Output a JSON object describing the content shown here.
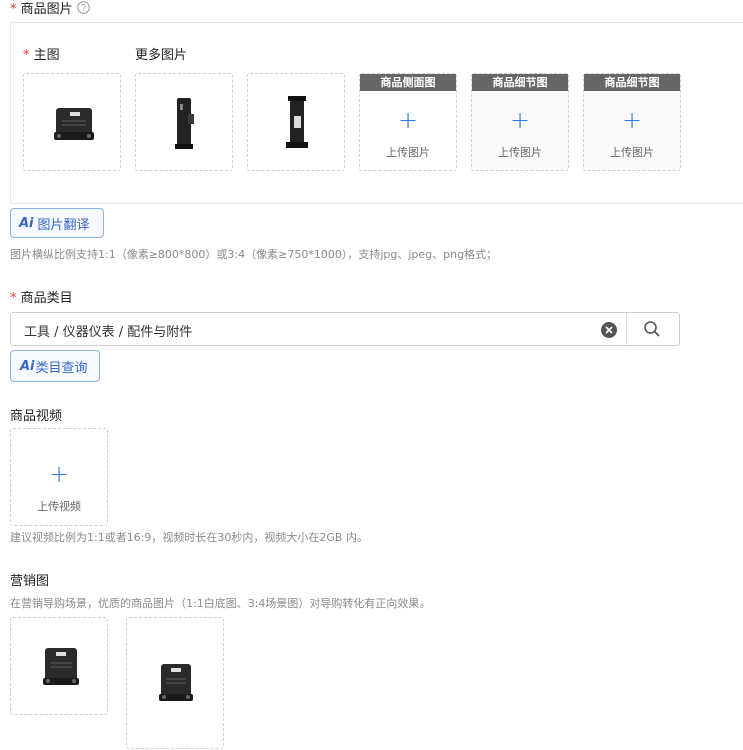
{
  "main_image_section": {
    "required_mark": "*",
    "title": "商品图片",
    "help_icon": "question-circle-icon",
    "main_label": "主图",
    "more_label": "更多图片",
    "tiles": [
      {
        "kind": "image",
        "icon": "device-front-icon"
      },
      {
        "kind": "image",
        "icon": "device-side-icon"
      },
      {
        "kind": "image",
        "icon": "device-side-icon"
      },
      {
        "kind": "upload",
        "header": "商品侧面图",
        "plus": "+",
        "text": "上传图片"
      },
      {
        "kind": "upload",
        "header": "商品细节图",
        "plus": "+",
        "text": "上传图片"
      },
      {
        "kind": "upload",
        "header": "商品细节图",
        "plus": "+",
        "text": "上传图片"
      }
    ],
    "ai_button": {
      "mark": "Ai",
      "label": "图片翻译"
    },
    "hint": "图片横纵比例支持1:1（像素≥800*800）或3:4（像素≥750*1000），支持jpg、jpeg、png格式；"
  },
  "category_section": {
    "required_mark": "*",
    "title": "商品类目",
    "value": "工具 / 仪器仪表 / 配件与附件",
    "ai_button": {
      "mark": "Ai",
      "label": "类目查询"
    }
  },
  "video_section": {
    "title": "商品视频",
    "plus": "+",
    "upload_text": "上传视频",
    "hint": "建议视频比例为1:1或者16:9，视频时长在30秒内，视频大小在2GB 内。"
  },
  "marketing_section": {
    "title": "营销图",
    "hint": "在营销导购场景，优质的商品图片（1:1白底图、3:4场景图）对导购转化有正向效果。"
  }
}
